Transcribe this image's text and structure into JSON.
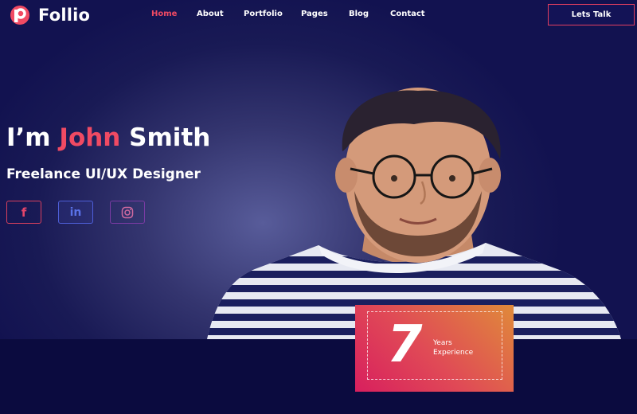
{
  "brand": {
    "name": "Follio",
    "color": "#f04a63"
  },
  "nav": {
    "items": [
      {
        "label": "Home",
        "active": true
      },
      {
        "label": "About"
      },
      {
        "label": "Portfolio"
      },
      {
        "label": "Pages"
      },
      {
        "label": "Blog"
      },
      {
        "label": "Contact"
      }
    ],
    "cta_label": "Lets Talk"
  },
  "hero": {
    "prefix": "I’m ",
    "name": "John",
    "surname": " Smith",
    "subtitle": "Freelance UI/UX Designer",
    "socials": [
      {
        "icon": "facebook-icon",
        "glyph": "f"
      },
      {
        "icon": "linkedin-icon",
        "glyph": "in"
      },
      {
        "icon": "instagram-icon"
      }
    ]
  },
  "experience": {
    "number": "7",
    "line1": "Years",
    "line2": "Experience"
  },
  "colors": {
    "background": "#0e0e4a",
    "accent": "#f04a63",
    "card_start": "#d81f5e",
    "card_end": "#e08a3a"
  }
}
